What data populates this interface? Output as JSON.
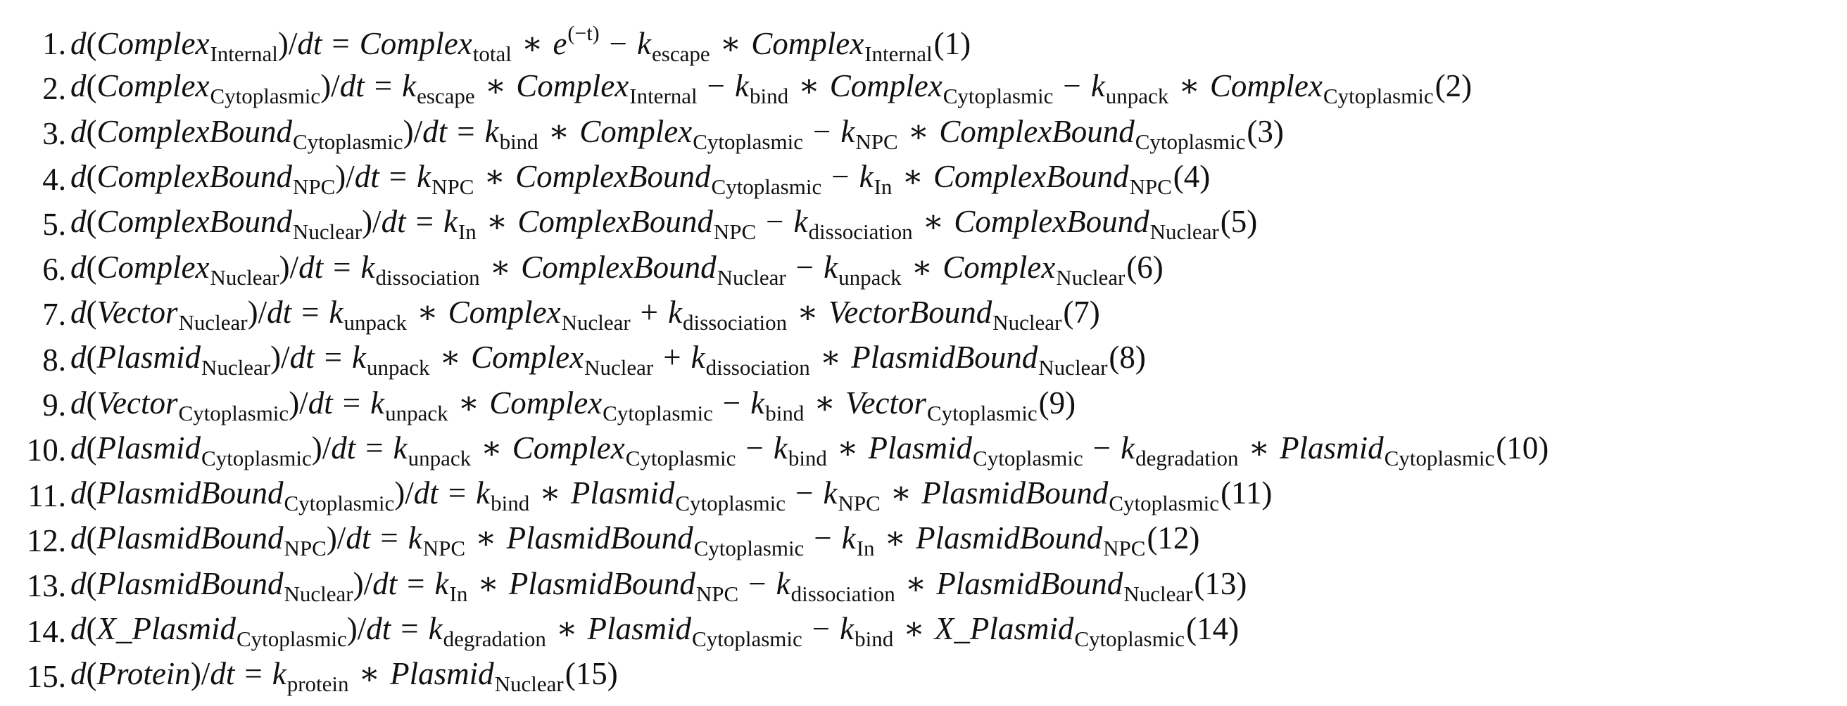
{
  "equations": [
    {
      "n": "1.",
      "lhs": [
        {
          "t": "v",
          "s": "d"
        },
        {
          "t": "u",
          "s": "("
        },
        {
          "t": "v",
          "s": "Complex"
        },
        {
          "t": "sub",
          "s": "Internal"
        },
        {
          "t": "u",
          "s": ")/"
        },
        {
          "t": "v",
          "s": "dt"
        }
      ],
      "rhs": [
        {
          "t": "op",
          "s": "="
        },
        {
          "t": "v",
          "s": "Complex"
        },
        {
          "t": "sub",
          "s": "total"
        },
        {
          "t": "op",
          "s": "∗"
        },
        {
          "t": "v",
          "s": "e"
        },
        {
          "t": "sup",
          "s": "(−t)"
        },
        {
          "t": "op",
          "s": "−"
        },
        {
          "t": "v",
          "s": "k"
        },
        {
          "t": "sub",
          "s": "escape"
        },
        {
          "t": "op",
          "s": "∗"
        },
        {
          "t": "v",
          "s": "Complex"
        },
        {
          "t": "sub",
          "s": "Internal"
        },
        {
          "t": "tag",
          "s": "(1)"
        }
      ]
    },
    {
      "n": "2.",
      "lhs": [
        {
          "t": "v",
          "s": "d"
        },
        {
          "t": "u",
          "s": "("
        },
        {
          "t": "v",
          "s": "Complex"
        },
        {
          "t": "sub",
          "s": "Cytoplasmic"
        },
        {
          "t": "u",
          "s": ")/"
        },
        {
          "t": "v",
          "s": "dt"
        }
      ],
      "rhs": [
        {
          "t": "op",
          "s": "="
        },
        {
          "t": "v",
          "s": "k"
        },
        {
          "t": "sub",
          "s": "escape"
        },
        {
          "t": "op",
          "s": "∗"
        },
        {
          "t": "v",
          "s": "Complex"
        },
        {
          "t": "sub",
          "s": "Internal"
        },
        {
          "t": "op",
          "s": "−"
        },
        {
          "t": "v",
          "s": "k"
        },
        {
          "t": "sub",
          "s": "bind"
        },
        {
          "t": "op",
          "s": "∗"
        },
        {
          "t": "v",
          "s": "Complex"
        },
        {
          "t": "sub",
          "s": "Cytoplasmic"
        },
        {
          "t": "op",
          "s": "−"
        },
        {
          "t": "v",
          "s": "k"
        },
        {
          "t": "sub",
          "s": "unpack"
        },
        {
          "t": "op",
          "s": "∗"
        },
        {
          "t": "v",
          "s": "Complex"
        },
        {
          "t": "sub",
          "s": "Cytoplasmic"
        },
        {
          "t": "tag",
          "s": "(2)"
        }
      ]
    },
    {
      "n": "3.",
      "lhs": [
        {
          "t": "v",
          "s": "d"
        },
        {
          "t": "u",
          "s": "("
        },
        {
          "t": "v",
          "s": "ComplexBound"
        },
        {
          "t": "sub",
          "s": "Cytoplasmic"
        },
        {
          "t": "u",
          "s": ")/"
        },
        {
          "t": "v",
          "s": "dt"
        }
      ],
      "rhs": [
        {
          "t": "op",
          "s": "="
        },
        {
          "t": "v",
          "s": "k"
        },
        {
          "t": "sub",
          "s": "bind"
        },
        {
          "t": "op",
          "s": "∗"
        },
        {
          "t": "v",
          "s": "Complex"
        },
        {
          "t": "sub",
          "s": "Cytoplasmic"
        },
        {
          "t": "op",
          "s": "−"
        },
        {
          "t": "v",
          "s": "k"
        },
        {
          "t": "sub",
          "s": "NPC"
        },
        {
          "t": "op",
          "s": "∗"
        },
        {
          "t": "v",
          "s": "ComplexBound"
        },
        {
          "t": "sub",
          "s": "Cytoplasmic"
        },
        {
          "t": "tag",
          "s": "(3)"
        }
      ]
    },
    {
      "n": "4.",
      "lhs": [
        {
          "t": "v",
          "s": "d"
        },
        {
          "t": "u",
          "s": "("
        },
        {
          "t": "v",
          "s": "ComplexBound"
        },
        {
          "t": "sub",
          "s": "NPC"
        },
        {
          "t": "u",
          "s": ")/"
        },
        {
          "t": "v",
          "s": "dt"
        }
      ],
      "rhs": [
        {
          "t": "op",
          "s": "="
        },
        {
          "t": "v",
          "s": "k"
        },
        {
          "t": "sub",
          "s": "NPC"
        },
        {
          "t": "op",
          "s": "∗"
        },
        {
          "t": "v",
          "s": "ComplexBound"
        },
        {
          "t": "sub",
          "s": "Cytoplasmic"
        },
        {
          "t": "op",
          "s": "−"
        },
        {
          "t": "v",
          "s": "k"
        },
        {
          "t": "sub",
          "s": "In"
        },
        {
          "t": "op",
          "s": "∗"
        },
        {
          "t": "v",
          "s": "ComplexBound"
        },
        {
          "t": "sub",
          "s": "NPC"
        },
        {
          "t": "tag",
          "s": "(4)"
        }
      ]
    },
    {
      "n": "5.",
      "lhs": [
        {
          "t": "v",
          "s": "d"
        },
        {
          "t": "u",
          "s": "("
        },
        {
          "t": "v",
          "s": "ComplexBound"
        },
        {
          "t": "sub",
          "s": "Nuclear"
        },
        {
          "t": "u",
          "s": ")/"
        },
        {
          "t": "v",
          "s": "dt"
        }
      ],
      "rhs": [
        {
          "t": "op",
          "s": "="
        },
        {
          "t": "v",
          "s": "k"
        },
        {
          "t": "sub",
          "s": "In"
        },
        {
          "t": "op",
          "s": "∗"
        },
        {
          "t": "v",
          "s": "ComplexBound"
        },
        {
          "t": "sub",
          "s": "NPC"
        },
        {
          "t": "op",
          "s": "−"
        },
        {
          "t": "v",
          "s": "k"
        },
        {
          "t": "sub",
          "s": "dissociation"
        },
        {
          "t": "op",
          "s": "∗"
        },
        {
          "t": "v",
          "s": "ComplexBound"
        },
        {
          "t": "sub",
          "s": "Nuclear"
        },
        {
          "t": "tag",
          "s": "(5)"
        }
      ]
    },
    {
      "n": "6.",
      "lhs": [
        {
          "t": "v",
          "s": "d"
        },
        {
          "t": "u",
          "s": "("
        },
        {
          "t": "v",
          "s": "Complex"
        },
        {
          "t": "sub",
          "s": "Nuclear"
        },
        {
          "t": "u",
          "s": ")/"
        },
        {
          "t": "v",
          "s": "dt"
        }
      ],
      "rhs": [
        {
          "t": "op",
          "s": "="
        },
        {
          "t": "v",
          "s": "k"
        },
        {
          "t": "sub",
          "s": "dissociation"
        },
        {
          "t": "op",
          "s": "∗"
        },
        {
          "t": "v",
          "s": "ComplexBound"
        },
        {
          "t": "sub",
          "s": "Nuclear"
        },
        {
          "t": "op",
          "s": "−"
        },
        {
          "t": "v",
          "s": "k"
        },
        {
          "t": "sub",
          "s": "unpack"
        },
        {
          "t": "op",
          "s": "∗"
        },
        {
          "t": "v",
          "s": "Complex"
        },
        {
          "t": "sub",
          "s": "Nuclear"
        },
        {
          "t": "tag",
          "s": "(6)"
        }
      ]
    },
    {
      "n": "7.",
      "lhs": [
        {
          "t": "v",
          "s": "d"
        },
        {
          "t": "u",
          "s": "("
        },
        {
          "t": "v",
          "s": "Vector"
        },
        {
          "t": "sub",
          "s": "Nuclear"
        },
        {
          "t": "u",
          "s": ")/"
        },
        {
          "t": "v",
          "s": "dt"
        }
      ],
      "rhs": [
        {
          "t": "op",
          "s": "="
        },
        {
          "t": "v",
          "s": "k"
        },
        {
          "t": "sub",
          "s": "unpack"
        },
        {
          "t": "op",
          "s": "∗"
        },
        {
          "t": "v",
          "s": "Complex"
        },
        {
          "t": "sub",
          "s": "Nuclear"
        },
        {
          "t": "op",
          "s": "+"
        },
        {
          "t": "v",
          "s": "k"
        },
        {
          "t": "sub",
          "s": "dissociation"
        },
        {
          "t": "op",
          "s": "∗"
        },
        {
          "t": "v",
          "s": "VectorBound"
        },
        {
          "t": "sub",
          "s": "Nuclear"
        },
        {
          "t": "tag",
          "s": "(7)"
        }
      ]
    },
    {
      "n": "8.",
      "lhs": [
        {
          "t": "v",
          "s": "d"
        },
        {
          "t": "u",
          "s": "("
        },
        {
          "t": "v",
          "s": "Plasmid"
        },
        {
          "t": "sub",
          "s": "Nuclear"
        },
        {
          "t": "u",
          "s": ")/"
        },
        {
          "t": "v",
          "s": "dt"
        }
      ],
      "rhs": [
        {
          "t": "op",
          "s": "="
        },
        {
          "t": "v",
          "s": "k"
        },
        {
          "t": "sub",
          "s": "unpack"
        },
        {
          "t": "op",
          "s": "∗"
        },
        {
          "t": "v",
          "s": "Complex"
        },
        {
          "t": "sub",
          "s": "Nuclear"
        },
        {
          "t": "op",
          "s": "+"
        },
        {
          "t": "v",
          "s": "k"
        },
        {
          "t": "sub",
          "s": "dissociation"
        },
        {
          "t": "op",
          "s": "∗"
        },
        {
          "t": "v",
          "s": "PlasmidBound"
        },
        {
          "t": "sub",
          "s": "Nuclear"
        },
        {
          "t": "tag",
          "s": "(8)"
        }
      ]
    },
    {
      "n": "9.",
      "lhs": [
        {
          "t": "v",
          "s": "d"
        },
        {
          "t": "u",
          "s": "("
        },
        {
          "t": "v",
          "s": "Vector"
        },
        {
          "t": "sub",
          "s": "Cytoplasmic"
        },
        {
          "t": "u",
          "s": ")/"
        },
        {
          "t": "v",
          "s": "dt"
        }
      ],
      "rhs": [
        {
          "t": "op",
          "s": "="
        },
        {
          "t": "v",
          "s": "k"
        },
        {
          "t": "sub",
          "s": "unpack"
        },
        {
          "t": "op",
          "s": "∗"
        },
        {
          "t": "v",
          "s": "Complex"
        },
        {
          "t": "sub",
          "s": "Cytoplasmic"
        },
        {
          "t": "op",
          "s": "−"
        },
        {
          "t": "v",
          "s": "k"
        },
        {
          "t": "sub",
          "s": "bind"
        },
        {
          "t": "op",
          "s": "∗"
        },
        {
          "t": "v",
          "s": "Vector"
        },
        {
          "t": "sub",
          "s": "Cytoplasmic"
        },
        {
          "t": "tag",
          "s": "(9)"
        }
      ]
    },
    {
      "n": "10.",
      "lhs": [
        {
          "t": "v",
          "s": "d"
        },
        {
          "t": "u",
          "s": "("
        },
        {
          "t": "v",
          "s": "Plasmid"
        },
        {
          "t": "sub",
          "s": "Cytoplasmic"
        },
        {
          "t": "u",
          "s": ")/"
        },
        {
          "t": "v",
          "s": "dt"
        }
      ],
      "rhs": [
        {
          "t": "op",
          "s": "="
        },
        {
          "t": "v",
          "s": "k"
        },
        {
          "t": "sub",
          "s": "unpack"
        },
        {
          "t": "op",
          "s": "∗"
        },
        {
          "t": "v",
          "s": "Complex"
        },
        {
          "t": "sub",
          "s": "Cytoplasmic"
        },
        {
          "t": "op",
          "s": "−"
        },
        {
          "t": "v",
          "s": "k"
        },
        {
          "t": "sub",
          "s": "bind"
        },
        {
          "t": "op",
          "s": "∗"
        },
        {
          "t": "v",
          "s": "Plasmid"
        },
        {
          "t": "sub",
          "s": "Cytoplasmic"
        },
        {
          "t": "op",
          "s": "−"
        },
        {
          "t": "v",
          "s": "k"
        },
        {
          "t": "sub",
          "s": "degradation"
        },
        {
          "t": "op",
          "s": "∗"
        },
        {
          "t": "v",
          "s": "Plasmid"
        },
        {
          "t": "sub",
          "s": "Cytoplasmic"
        },
        {
          "t": "tag",
          "s": "(10)"
        }
      ]
    },
    {
      "n": "11.",
      "lhs": [
        {
          "t": "v",
          "s": "d"
        },
        {
          "t": "u",
          "s": "("
        },
        {
          "t": "v",
          "s": "PlasmidBound"
        },
        {
          "t": "sub",
          "s": "Cytoplasmic"
        },
        {
          "t": "u",
          "s": ")/"
        },
        {
          "t": "v",
          "s": "dt"
        }
      ],
      "rhs": [
        {
          "t": "op",
          "s": "="
        },
        {
          "t": "v",
          "s": "k"
        },
        {
          "t": "sub",
          "s": "bind"
        },
        {
          "t": "op",
          "s": "∗"
        },
        {
          "t": "v",
          "s": "Plasmid"
        },
        {
          "t": "sub",
          "s": "Cytoplasmic"
        },
        {
          "t": "op",
          "s": "−"
        },
        {
          "t": "v",
          "s": "k"
        },
        {
          "t": "sub",
          "s": "NPC"
        },
        {
          "t": "op",
          "s": "∗"
        },
        {
          "t": "v",
          "s": "PlasmidBound"
        },
        {
          "t": "sub",
          "s": "Cytoplasmic"
        },
        {
          "t": "tag",
          "s": "(11)"
        }
      ]
    },
    {
      "n": "12.",
      "lhs": [
        {
          "t": "v",
          "s": "d"
        },
        {
          "t": "u",
          "s": "("
        },
        {
          "t": "v",
          "s": "PlasmidBound"
        },
        {
          "t": "sub",
          "s": "NPC"
        },
        {
          "t": "u",
          "s": ")/"
        },
        {
          "t": "v",
          "s": "dt"
        }
      ],
      "rhs": [
        {
          "t": "op",
          "s": "="
        },
        {
          "t": "v",
          "s": "k"
        },
        {
          "t": "sub",
          "s": "NPC"
        },
        {
          "t": "op",
          "s": "∗"
        },
        {
          "t": "v",
          "s": "PlasmidBound"
        },
        {
          "t": "sub",
          "s": "Cytoplasmic"
        },
        {
          "t": "op",
          "s": "−"
        },
        {
          "t": "v",
          "s": "k"
        },
        {
          "t": "sub",
          "s": "In"
        },
        {
          "t": "op",
          "s": "∗"
        },
        {
          "t": "v",
          "s": "PlasmidBound"
        },
        {
          "t": "sub",
          "s": "NPC"
        },
        {
          "t": "tag",
          "s": "(12)"
        }
      ]
    },
    {
      "n": "13.",
      "lhs": [
        {
          "t": "v",
          "s": "d"
        },
        {
          "t": "u",
          "s": "("
        },
        {
          "t": "v",
          "s": "PlasmidBound"
        },
        {
          "t": "sub",
          "s": "Nuclear"
        },
        {
          "t": "u",
          "s": ")/"
        },
        {
          "t": "v",
          "s": "dt"
        }
      ],
      "rhs": [
        {
          "t": "op",
          "s": "="
        },
        {
          "t": "v",
          "s": "k"
        },
        {
          "t": "sub",
          "s": "In"
        },
        {
          "t": "op",
          "s": "∗"
        },
        {
          "t": "v",
          "s": "PlasmidBound"
        },
        {
          "t": "sub",
          "s": "NPC"
        },
        {
          "t": "op",
          "s": "−"
        },
        {
          "t": "v",
          "s": "k"
        },
        {
          "t": "sub",
          "s": "dissociation"
        },
        {
          "t": "op",
          "s": "∗"
        },
        {
          "t": "v",
          "s": "PlasmidBound"
        },
        {
          "t": "sub",
          "s": "Nuclear"
        },
        {
          "t": "tag",
          "s": "(13)"
        }
      ]
    },
    {
      "n": "14.",
      "lhs": [
        {
          "t": "v",
          "s": "d"
        },
        {
          "t": "u",
          "s": "("
        },
        {
          "t": "v",
          "s": "X_Plasmid"
        },
        {
          "t": "sub",
          "s": "Cytoplasmic"
        },
        {
          "t": "u",
          "s": ")/"
        },
        {
          "t": "v",
          "s": "dt"
        }
      ],
      "rhs": [
        {
          "t": "op",
          "s": "="
        },
        {
          "t": "v",
          "s": "k"
        },
        {
          "t": "sub",
          "s": "degradation"
        },
        {
          "t": "op",
          "s": "∗"
        },
        {
          "t": "v",
          "s": "Plasmid"
        },
        {
          "t": "sub",
          "s": "Cytoplasmic"
        },
        {
          "t": "op",
          "s": "−"
        },
        {
          "t": "v",
          "s": "k"
        },
        {
          "t": "sub",
          "s": "bind"
        },
        {
          "t": "op",
          "s": "∗"
        },
        {
          "t": "v",
          "s": "X_Plasmid"
        },
        {
          "t": "sub",
          "s": "Cytoplasmic"
        },
        {
          "t": "tag",
          "s": "(14)"
        }
      ]
    },
    {
      "n": "15.",
      "lhs": [
        {
          "t": "v",
          "s": "d"
        },
        {
          "t": "u",
          "s": "("
        },
        {
          "t": "v",
          "s": "Protein"
        },
        {
          "t": "u",
          "s": ")/"
        },
        {
          "t": "v",
          "s": "dt"
        }
      ],
      "rhs": [
        {
          "t": "op",
          "s": "="
        },
        {
          "t": "v",
          "s": "k"
        },
        {
          "t": "sub",
          "s": "protein"
        },
        {
          "t": "op",
          "s": "∗"
        },
        {
          "t": "v",
          "s": "Plasmid"
        },
        {
          "t": "sub",
          "s": "Nuclear"
        },
        {
          "t": "tag",
          "s": "(15)"
        }
      ]
    }
  ]
}
